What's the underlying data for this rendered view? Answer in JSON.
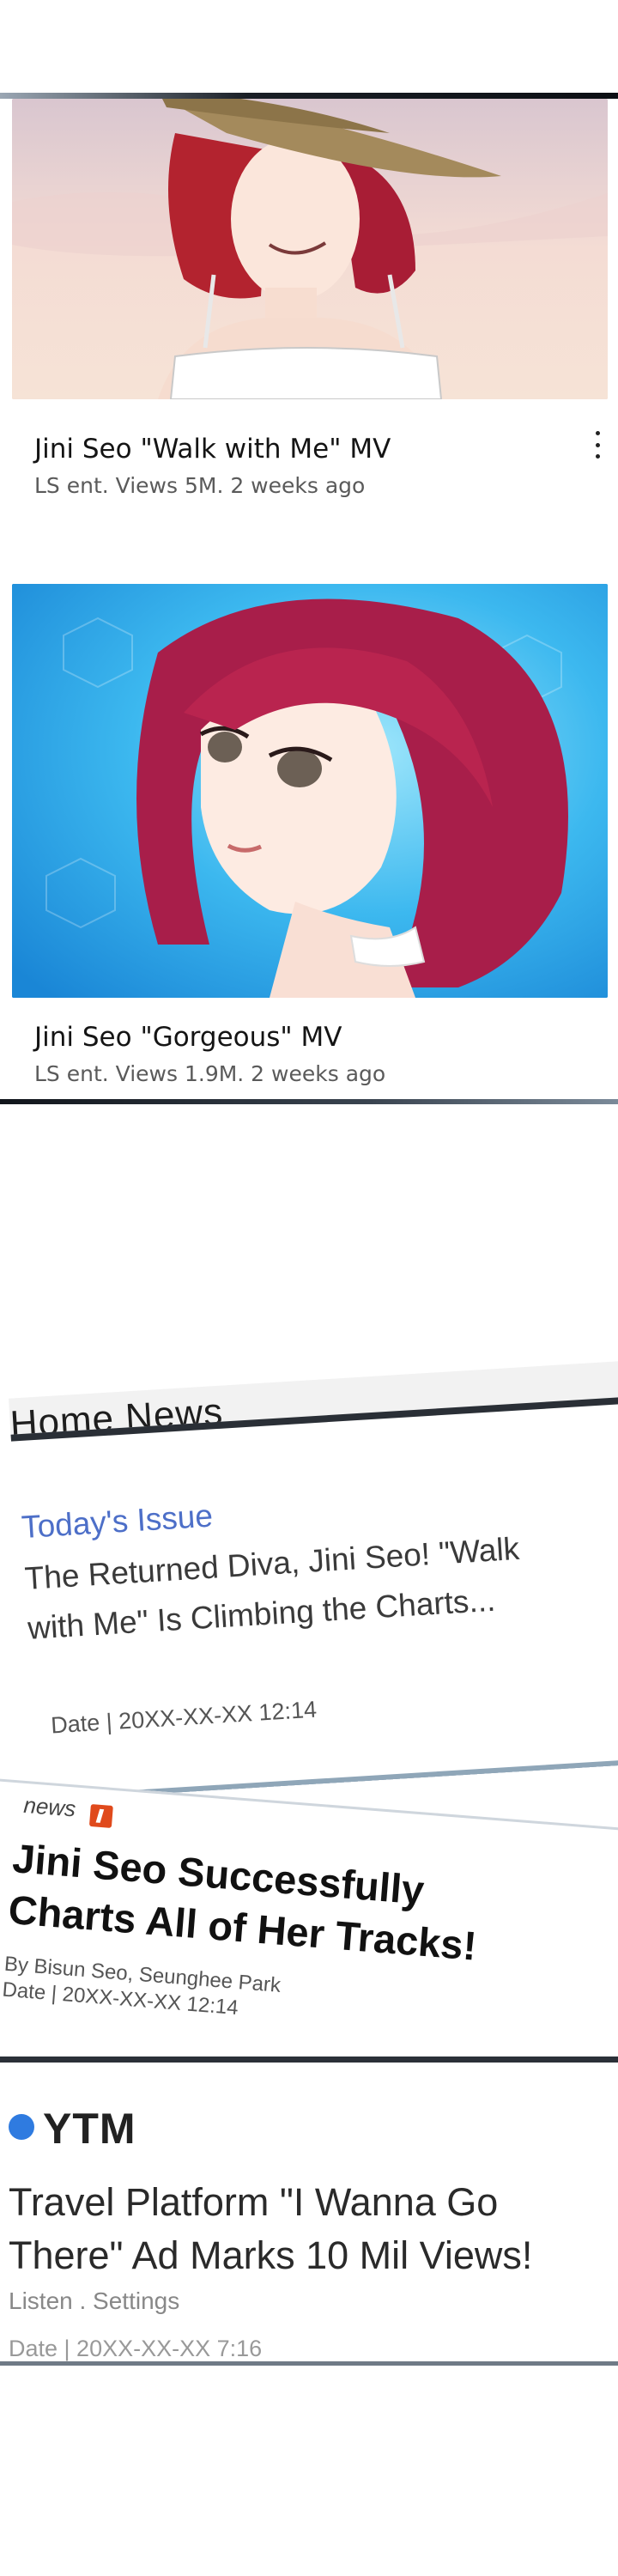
{
  "feed": {
    "videos": [
      {
        "title": "Jini Seo \"Walk with Me\" MV",
        "meta": "LS ent.   Views 5M. 2 weeks ago"
      },
      {
        "title": "Jini Seo \"Gorgeous\" MV",
        "meta": "LS ent.   Views 1.9M. 2 weeks ago"
      }
    ]
  },
  "home_news": {
    "header": "Home News",
    "section": "Today's Issue",
    "headline": "The Returned Diva, Jini Seo! \"Walk with Me\" Is Climbing the Charts...",
    "date": "Date  |  20XX-XX-XX 12:14"
  },
  "news_article": {
    "tag": "news",
    "headline": "Jini Seo Successfully Charts All of Her Tracks!",
    "byline": "By Bisun Seo, Seunghee Park",
    "date": "Date  |  20XX-XX-XX 12:14"
  },
  "ytm": {
    "logo": "YTM",
    "headline": "Travel Platform \"I Wanna Go There\" Ad Marks 10 Mil Views!",
    "listen": "Listen . Settings",
    "date": "Date  |  20XX-XX-XX 7:16"
  },
  "colors": {
    "accent_blue": "#4d6fc8",
    "badge_orange": "#e04a1c",
    "ytm_dot": "#2f7be0"
  }
}
